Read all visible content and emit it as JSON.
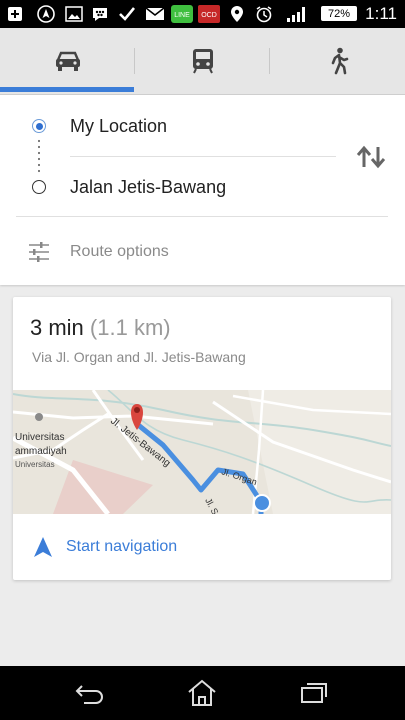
{
  "status_bar": {
    "time": "1:11",
    "battery": "72%",
    "icons": [
      "add-icon",
      "navigation-app-icon",
      "image-icon",
      "bbm-icon",
      "check-icon",
      "mail-icon",
      "line-app-icon",
      "ocd-app-icon",
      "location-icon",
      "alarm-icon",
      "signal-icon",
      "battery-icon"
    ]
  },
  "modes": [
    {
      "name": "car-icon",
      "selected": true
    },
    {
      "name": "transit-icon",
      "selected": false
    },
    {
      "name": "walk-icon",
      "selected": false
    }
  ],
  "route": {
    "origin": "My Location",
    "destination": "Jalan Jetis-Bawang",
    "options_label": "Route options"
  },
  "result": {
    "duration": "3 min",
    "distance": "(1.1 km)",
    "via": "Via Jl. Organ and Jl. Jetis-Bawang",
    "map_labels": {
      "road_1": "Jl. Jetis-Bawang",
      "road_2": "Jl. Organ",
      "road_3": "Jl. S",
      "place_1": "Universitas",
      "place_2": "ammadiyah",
      "place_3": "Universitas"
    },
    "start_label": "Start navigation"
  },
  "colors": {
    "accent": "#3b7dd8",
    "route": "#4a8fe0",
    "map_bg": "#e9e5dc",
    "pin": "#d9463e"
  }
}
